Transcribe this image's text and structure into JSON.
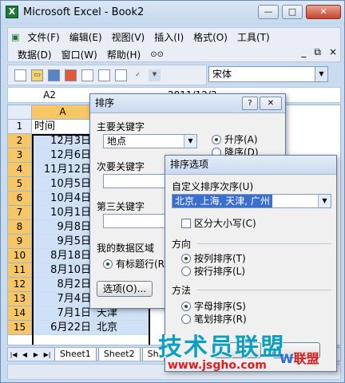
{
  "window": {
    "title": "Microsoft Excel - Book2",
    "minimize": "—",
    "maximize": "□",
    "close": "✕"
  },
  "menubar": {
    "row1": [
      "文件(F)",
      "编辑(E)",
      "视图(V)",
      "插入(I)",
      "格式(O)",
      "工具(T)"
    ],
    "row2": [
      "数据(D)",
      "窗口(W)",
      "帮助(H)"
    ],
    "mdi_min": "_",
    "mdi_restore": "⧉",
    "mdi_close": "×"
  },
  "toolbar": {
    "font_name": "宋体"
  },
  "formula_bar": {
    "name_box": "A2",
    "content": "2011/12/3"
  },
  "sheet": {
    "columns": [
      "A",
      "B"
    ],
    "rows": [
      {
        "num": "1",
        "a": "时间",
        "b": ""
      },
      {
        "num": "2",
        "a": "12月3日",
        "b": ""
      },
      {
        "num": "3",
        "a": "12月6日",
        "b": ""
      },
      {
        "num": "4",
        "a": "11月12日",
        "b": ""
      },
      {
        "num": "5",
        "a": "10月5日",
        "b": ""
      },
      {
        "num": "6",
        "a": "10月4日",
        "b": ""
      },
      {
        "num": "7",
        "a": "10月1日",
        "b": ""
      },
      {
        "num": "8",
        "a": "9月8日",
        "b": ""
      },
      {
        "num": "9",
        "a": "9月5日",
        "b": ""
      },
      {
        "num": "10",
        "a": "8月18日",
        "b": ""
      },
      {
        "num": "11",
        "a": "8月10日",
        "b": ""
      },
      {
        "num": "12",
        "a": "8月2日",
        "b": ""
      },
      {
        "num": "13",
        "a": "7月4日",
        "b": "北京"
      },
      {
        "num": "14",
        "a": "7月1日",
        "b": "天津"
      },
      {
        "num": "15",
        "a": "6月22日",
        "b": "北京"
      }
    ],
    "tabs": [
      "Sheet1",
      "Sheet2",
      "Sh"
    ]
  },
  "sort_dialog": {
    "title": "排序",
    "primary_key_label": "主要关键字",
    "primary_key_value": "地点",
    "asc": "升序(A)",
    "desc": "降序(D)",
    "secondary_key_label": "次要关键字",
    "third_key_label": "第三关键字",
    "data_range_label": "我的数据区域",
    "header_row": "有标题行(R)",
    "options_button": "选项(O)..."
  },
  "options_dialog": {
    "title": "排序选项",
    "custom_order_label": "自定义排序次序(U)",
    "custom_order_value": "北京, 上海, 天津, 广州",
    "case_sensitive": "区分大小写(C)",
    "direction_label": "方向",
    "by_column": "按列排序(T)",
    "by_row": "按行排序(L)",
    "method_label": "方法",
    "alphabetic": "字母排序(S)",
    "stroke": "笔划排序(R)"
  },
  "watermark": {
    "text": "技术员联盟",
    "url": "www.jsgho.com",
    "logo_w": "W",
    "logo_rest": "联盟"
  }
}
